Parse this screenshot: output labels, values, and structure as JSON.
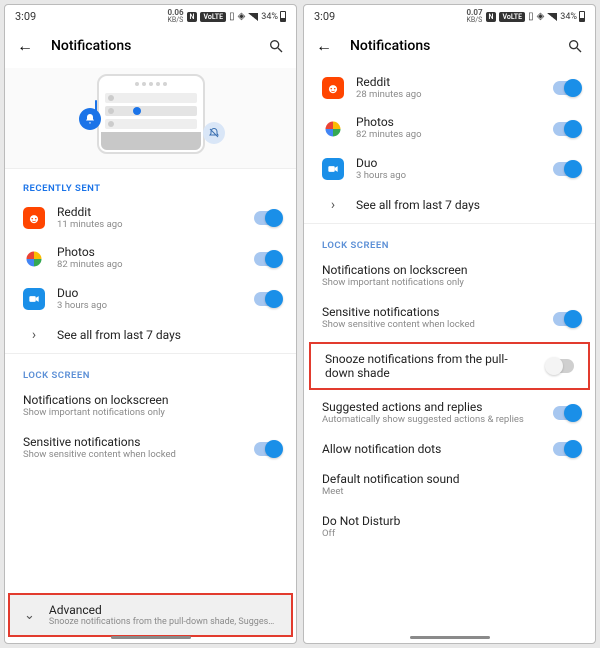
{
  "status": {
    "time": "3:09",
    "net_rate": "0.06",
    "net_unit": "KB/S",
    "net_rate2": "0.07",
    "n_badge": "N",
    "volte": "VoLTE",
    "battery": "34%"
  },
  "header": {
    "title": "Notifications"
  },
  "sections": {
    "recently_sent": "RECENTLY SENT",
    "lock_screen": "LOCK SCREEN"
  },
  "apps": {
    "reddit": {
      "name": "Reddit",
      "sub_left": "11 minutes ago",
      "sub_right": "28 minutes ago"
    },
    "photos": {
      "name": "Photos",
      "sub": "82 minutes ago"
    },
    "duo": {
      "name": "Duo",
      "sub": "3 hours ago"
    }
  },
  "see_all": "See all from last 7 days",
  "lock": {
    "on_lock": {
      "label": "Notifications on lockscreen",
      "sub": "Show important notifications only"
    },
    "sensitive": {
      "label": "Sensitive notifications",
      "sub": "Show sensitive content when locked"
    }
  },
  "advanced": {
    "label": "Advanced",
    "sub": "Snooze notifications from the pull-down shade, Suggested action…"
  },
  "right_extra": {
    "snooze": {
      "label": "Snooze notifications from the pull-down shade"
    },
    "suggested": {
      "label": "Suggested actions and replies",
      "sub": "Automatically show suggested actions & replies"
    },
    "dots": {
      "label": "Allow notification dots"
    },
    "sound": {
      "label": "Default notification sound",
      "sub": "Meet"
    },
    "dnd": {
      "label": "Do Not Disturb",
      "sub": "Off"
    }
  }
}
